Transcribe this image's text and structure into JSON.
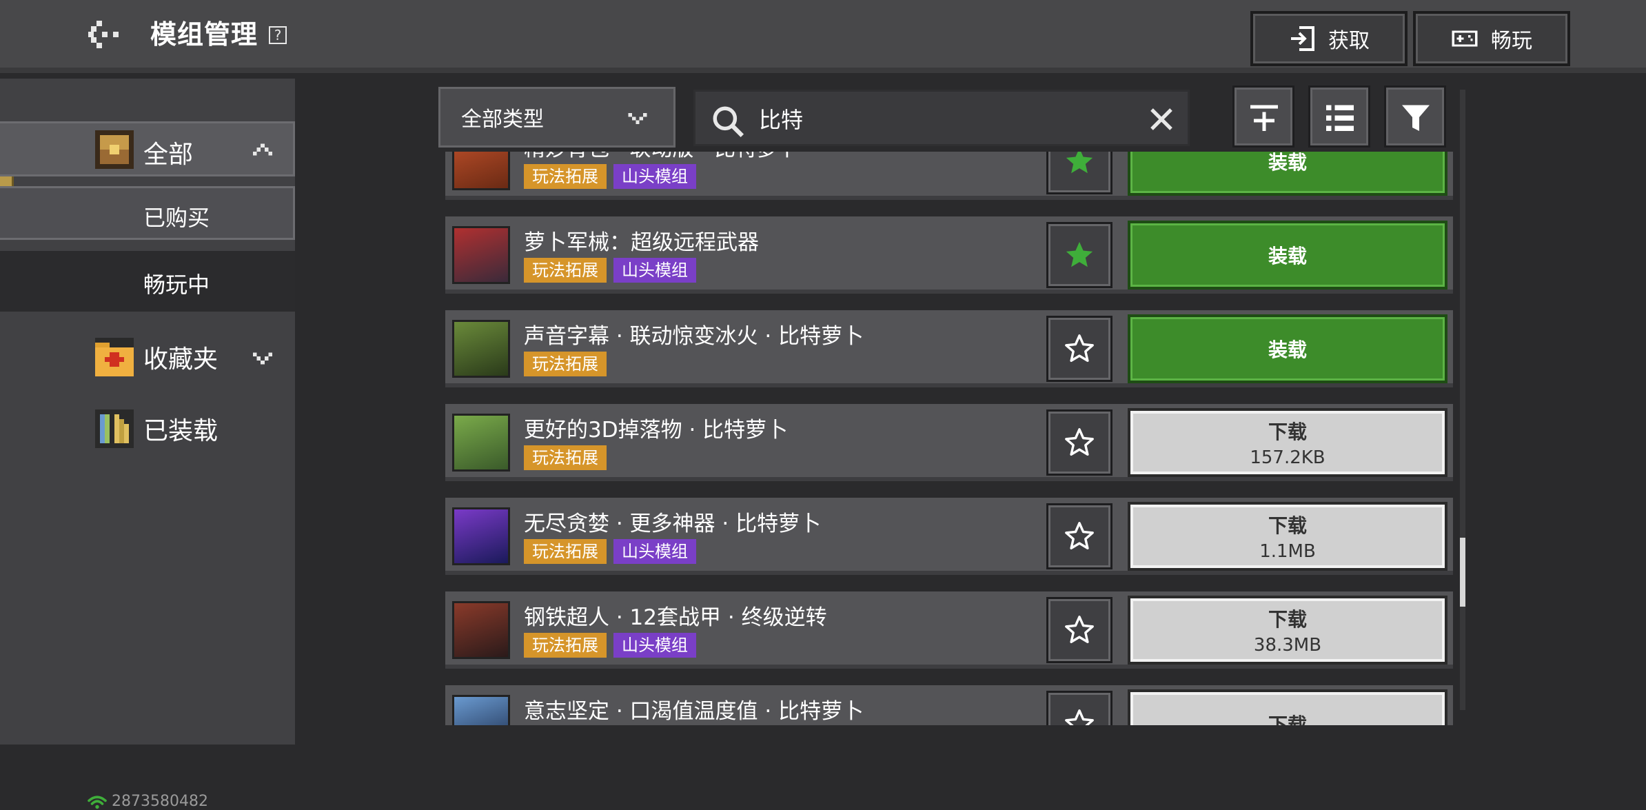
{
  "header": {
    "title": "模组管理",
    "help_icon": "?",
    "get_label": "获取",
    "play_label": "畅玩"
  },
  "sidebar": {
    "all": "全部",
    "purchased": "已购买",
    "playing": "畅玩中",
    "favorites": "收藏夹",
    "installed": "已装载",
    "account_id": "2873580482"
  },
  "toolbar": {
    "type_select": "全部类型",
    "search_value": "比特"
  },
  "colors": {
    "tag_gameplay": "#d6952a",
    "tag_shantou": "#7a3fc7",
    "load_green": "#3d8c2a",
    "star_green": "#3fae3a"
  },
  "mods": [
    {
      "title": "精妙背包 · 联动版 · 比特萝卜",
      "tags": [
        "玩法拓展",
        "山头模组"
      ],
      "starred": true,
      "action": "装载",
      "size": ""
    },
    {
      "title": "萝卜军械：超级远程武器",
      "tags": [
        "玩法拓展",
        "山头模组"
      ],
      "starred": true,
      "action": "装载",
      "size": ""
    },
    {
      "title": "声音字幕 · 联动惊变冰火 · 比特萝卜",
      "tags": [
        "玩法拓展"
      ],
      "starred": false,
      "action": "装载",
      "size": ""
    },
    {
      "title": "更好的3D掉落物 · 比特萝卜",
      "tags": [
        "玩法拓展"
      ],
      "starred": false,
      "action": "下载",
      "size": "157.2KB"
    },
    {
      "title": "无尽贪婪 · 更多神器 · 比特萝卜",
      "tags": [
        "玩法拓展",
        "山头模组"
      ],
      "starred": false,
      "action": "下载",
      "size": "1.1MB"
    },
    {
      "title": "钢铁超人 · 12套战甲 · 终级逆转",
      "tags": [
        "玩法拓展",
        "山头模组"
      ],
      "starred": false,
      "action": "下载",
      "size": "38.3MB"
    },
    {
      "title": "意志坚定 · 口渴值温度值 · 比特萝卜",
      "tags": [],
      "starred": false,
      "action": "下载",
      "size": ""
    }
  ]
}
